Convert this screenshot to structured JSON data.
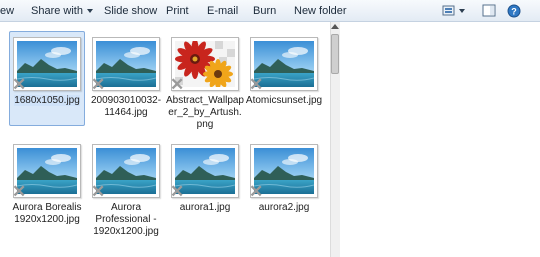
{
  "toolbar": {
    "cut_label": "ew",
    "share_label": "Share with",
    "slideshow_label": "Slide show",
    "print_label": "Print",
    "email_label": "E-mail",
    "burn_label": "Burn",
    "newfolder_label": "New folder"
  },
  "files": [
    {
      "name": "1680x1050.jpg",
      "selected": true,
      "image": "landscape"
    },
    {
      "name": "200903010032-11464.jpg",
      "selected": false,
      "image": "landscape"
    },
    {
      "name": "Abstract_Wallpaper_2_by_Artush.png",
      "selected": false,
      "image": "flowers"
    },
    {
      "name": "Atomicsunset.jpg",
      "selected": false,
      "image": "landscape"
    },
    {
      "name": "Aurora Borealis 1920x1200.jpg",
      "selected": false,
      "image": "landscape"
    },
    {
      "name": "Aurora Professional - 1920x1200.jpg",
      "selected": false,
      "image": "landscape"
    },
    {
      "name": "aurora1.jpg",
      "selected": false,
      "image": "landscape"
    },
    {
      "name": "aurora2.jpg",
      "selected": false,
      "image": "landscape"
    }
  ],
  "icons": {
    "views": "views-icon",
    "preview_pane": "preview-pane-icon",
    "help": "help-icon",
    "bad_thumbnail": "x-overlay-icon"
  },
  "colors": {
    "selection_fill": "#d9e8f9",
    "selection_border": "#84acdd",
    "toolbar_top": "#f7fafd",
    "toolbar_bottom": "#e3ebf4"
  }
}
